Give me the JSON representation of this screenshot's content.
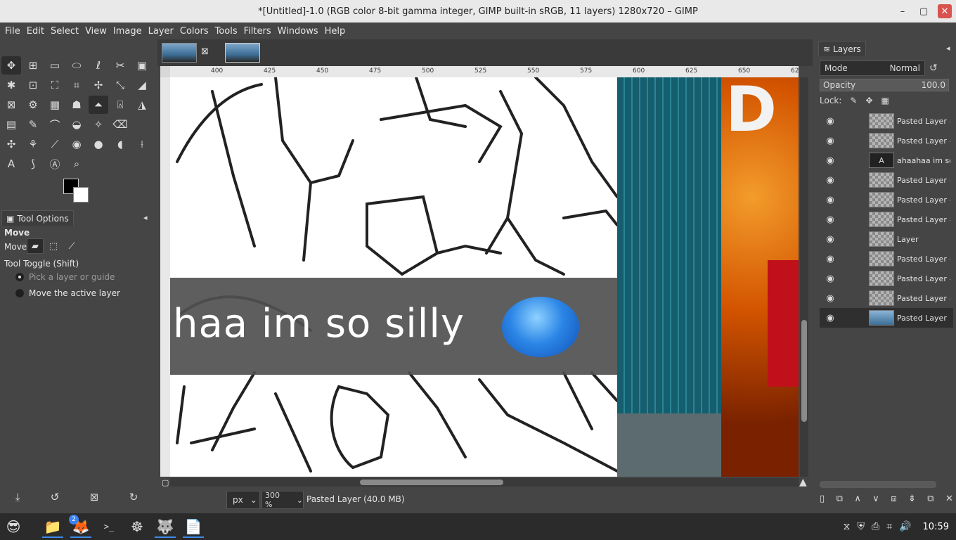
{
  "window": {
    "title": "*[Untitled]-1.0 (RGB color 8-bit gamma integer, GIMP built-in sRGB, 11 layers) 1280x720 – GIMP",
    "minimize": "–",
    "maximize": "▢",
    "close": "✕"
  },
  "menu": [
    "File",
    "Edit",
    "Select",
    "View",
    "Image",
    "Layer",
    "Colors",
    "Tools",
    "Filters",
    "Windows",
    "Help"
  ],
  "tools": {
    "row1": [
      "✥",
      "⊞",
      "▭",
      "⬭",
      "ℓ",
      "✂",
      "▣"
    ],
    "row2": [
      "✱",
      "⊡",
      "⛶",
      "⌗",
      "✢",
      "⤡",
      "◢"
    ],
    "row3": [
      "⊠",
      "⚙",
      "▦",
      "☗",
      "⏶",
      "⍓",
      "◮"
    ],
    "row4": [
      "▤",
      "✎",
      "⌒",
      "◒",
      "✧",
      "⌫",
      ""
    ],
    "row5": [
      "✣",
      "⚘",
      "⟋",
      "◉",
      "●",
      "◖",
      "⟊"
    ],
    "row6": [
      "A",
      "⟆",
      "Ⓐ",
      "⌕",
      "",
      "",
      ""
    ]
  },
  "tool_options": {
    "tab_label": "Tool Options",
    "tool_name": "Move",
    "move_label": "Move:",
    "toggle_label": "Tool Toggle  (Shift)",
    "option1": "Pick a layer or guide",
    "option2": "Move the active layer"
  },
  "toolbox_bottom": [
    "⤓",
    "↺",
    "⊠",
    "↻"
  ],
  "ruler": [
    "400",
    "425",
    "450",
    "475",
    "500",
    "525",
    "550",
    "575",
    "600",
    "625",
    "650",
    "62"
  ],
  "canvas": {
    "text": "haa im so silly",
    "letter": "D"
  },
  "status": {
    "unit": "px",
    "zoom": "300 %",
    "message": "Pasted Layer (40.0 MB)"
  },
  "layers_panel": {
    "tab_label": "Layers",
    "mode_label": "Mode",
    "mode_value": "Normal",
    "opacity_label": "Opacity",
    "opacity_value": "100.0",
    "lock_label": "Lock:",
    "layers": [
      {
        "name": "Pasted Layer #",
        "thumb": "check"
      },
      {
        "name": "Pasted Layer #",
        "thumb": "check"
      },
      {
        "name": "ahaahaa im so",
        "thumb": "text"
      },
      {
        "name": "Pasted Layer #",
        "thumb": "check"
      },
      {
        "name": "Pasted Layer #",
        "thumb": "check"
      },
      {
        "name": "Pasted Layer #",
        "thumb": "check"
      },
      {
        "name": "Layer",
        "thumb": "check"
      },
      {
        "name": "Pasted Layer #",
        "thumb": "check"
      },
      {
        "name": "Pasted Layer #",
        "thumb": "check"
      },
      {
        "name": "Pasted Layer #",
        "thumb": "check"
      },
      {
        "name": "Pasted Layer",
        "thumb": "img",
        "selected": true
      }
    ],
    "bottom_icons": [
      "▯",
      "⧉",
      "∧",
      "∨",
      "⧈",
      "⇟",
      "⧉",
      "✕"
    ]
  },
  "taskbar": {
    "apps": [
      "😎",
      "📁",
      "🦊",
      ">_",
      "☸",
      "🐺",
      "📄"
    ],
    "firefox_badge": "2",
    "tray": [
      "⧖",
      "⛨",
      "⎙",
      "⌗",
      "🔊"
    ],
    "clock": "10:59"
  }
}
